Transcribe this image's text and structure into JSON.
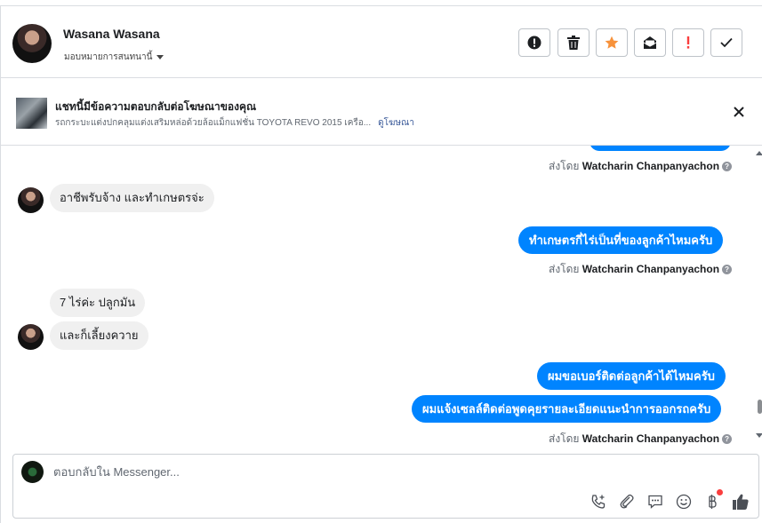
{
  "header": {
    "contact_name": "Wasana Wasana",
    "assign_label": "มอบหมายการสนทนานี้",
    "actions": [
      {
        "name": "mark-spam",
        "icon": "exclamation-circle-icon"
      },
      {
        "name": "delete",
        "icon": "trash-icon"
      },
      {
        "name": "star",
        "icon": "star-icon",
        "color": "#f7923b"
      },
      {
        "name": "mark-unread",
        "icon": "envelope-icon"
      },
      {
        "name": "follow-up",
        "icon": "exclamation-icon",
        "color": "#fa3e3e"
      },
      {
        "name": "mark-done",
        "icon": "check-icon"
      }
    ]
  },
  "ad": {
    "title": "แชทนี้มีข้อความตอบกลับต่อโฆษณาของคุณ",
    "subtitle": "รถกระบะแต่งปกคลุมแต่งเสริมหล่อด้วยล้อแม็กแฟชั่น TOYOTA REVO 2015 เครือ...",
    "link": "ดูโฆษณา"
  },
  "messages": {
    "sent_by_prefix": "ส่งโดย",
    "sender": "Watcharin Chanpanyachon",
    "in_1": "อาชีพรับจ้าง และทำเกษตรจ่ะ",
    "out_1": "ทำเกษตรกี่ไร่เป็นที่ของลูกค้าไหมครับ",
    "in_2": "7 ไร่ค่ะ ปลูกมัน",
    "in_3": "และก็เลี้ยงควาย",
    "out_2": "ผมขอเบอร์ติดต่อลูกค้าได้ไหมครับ",
    "out_3": "ผมแจ้งเซลล์ติดต่อพูดคุยรายละเอียดแนะนำการออกรถครับ"
  },
  "composer": {
    "placeholder": "ตอบกลับใน Messenger...",
    "icons": [
      "phone-plus-icon",
      "paperclip-icon",
      "chat-bubble-icon",
      "smiley-icon",
      "baht-icon",
      "thumbs-up-icon"
    ],
    "accent": "#4267b2"
  },
  "colors": {
    "outgoing_bubble": "#0084ff",
    "incoming_bubble": "#f0f0f0",
    "notification_dot": "#fa3e3e"
  }
}
